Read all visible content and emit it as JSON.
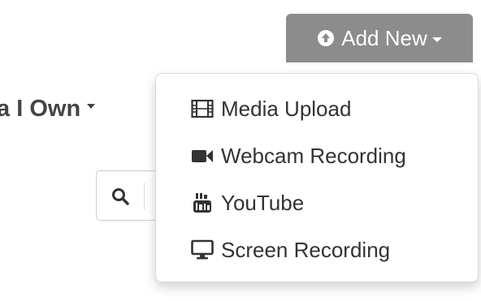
{
  "header": {
    "add_new_label": "Add New"
  },
  "filter": {
    "label": "ia I Own"
  },
  "dropdown": {
    "items": [
      {
        "label": "Media Upload",
        "icon": "film-icon"
      },
      {
        "label": "Webcam Recording",
        "icon": "video-camera-icon"
      },
      {
        "label": "YouTube",
        "icon": "youtube-icon"
      },
      {
        "label": "Screen Recording",
        "icon": "monitor-icon"
      }
    ]
  },
  "colors": {
    "button_bg": "#8c8c8c",
    "text": "#333333"
  }
}
